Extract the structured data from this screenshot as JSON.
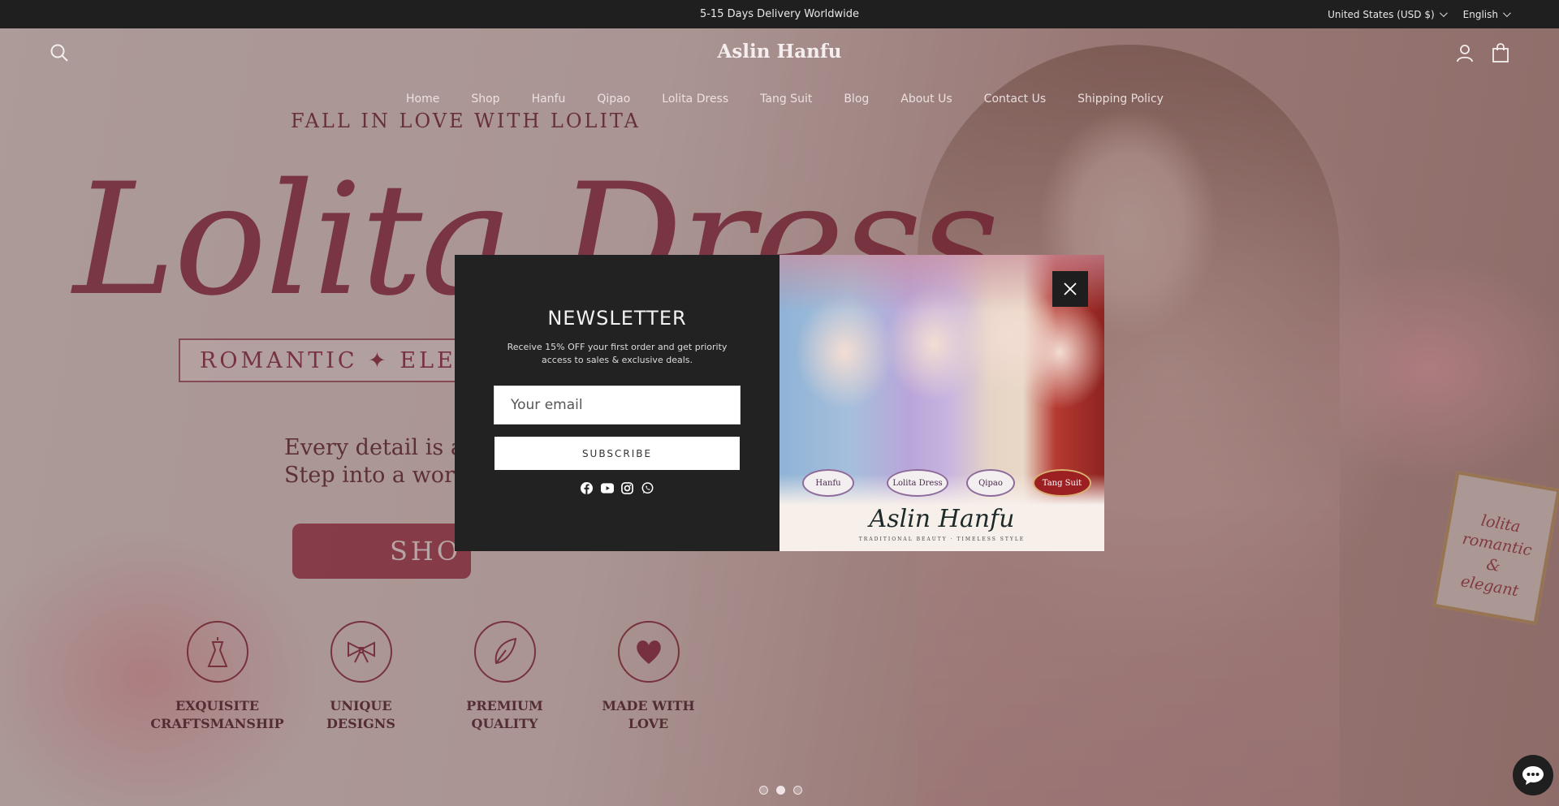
{
  "announcement": {
    "text": "5-15 Days Delivery Worldwide"
  },
  "locale": {
    "currency": "United States (USD $)",
    "language": "English"
  },
  "header": {
    "logo": "Aslin Hanfu",
    "nav": [
      "Home",
      "Shop",
      "Hanfu",
      "Qipao",
      "Lolita Dress",
      "Tang Suit",
      "Blog",
      "About Us",
      "Contact Us",
      "Shipping Policy"
    ]
  },
  "icons": {
    "search": "search-icon",
    "account": "user-icon",
    "cart": "bag-icon",
    "close": "close-icon",
    "chat": "chat-icon",
    "socials": [
      "facebook-icon",
      "youtube-icon",
      "instagram-icon",
      "whatsapp-icon"
    ]
  },
  "hero": {
    "eyebrow": "FALL IN LOVE WITH LOLITA",
    "script": "Lolita Dress",
    "ribbon": "ROMANTIC ✦ ELE",
    "copy_line1": "Every detail is a lo",
    "copy_line2": "Step into a world",
    "shop": "SHO",
    "features": [
      {
        "line1": "EXQUISITE",
        "line2": "CRAFTSMANSHIP",
        "icon": "dress-form-icon"
      },
      {
        "line1": "UNIQUE",
        "line2": "DESIGNS",
        "icon": "bow-icon"
      },
      {
        "line1": "PREMIUM",
        "line2": "QUALITY",
        "icon": "feather-icon"
      },
      {
        "line1": "MADE WITH",
        "line2": "LOVE",
        "icon": "heart-icon"
      }
    ],
    "frame_card": {
      "line1": "lolita",
      "line2": "romantic",
      "line3": "&",
      "line4": "elegant"
    },
    "slides": 3,
    "active_slide": 2
  },
  "newsletter": {
    "title": "NEWSLETTER",
    "description": "Receive 15% OFF your first order and get priority access to sales & exclusive deals.",
    "email_placeholder": "Your email",
    "subscribe_label": "SUBSCRIBE",
    "image": {
      "labels": [
        "Hanfu",
        "Lolita Dress",
        "Qipao",
        "Tang Suit"
      ],
      "brand": "Aslin Hanfu",
      "tagline": "TRADITIONAL BEAUTY · TIMELESS STYLE"
    }
  },
  "colors": {
    "accent": "#8a1e35",
    "dark": "#222222",
    "announce_bg": "#1f1f1f"
  }
}
